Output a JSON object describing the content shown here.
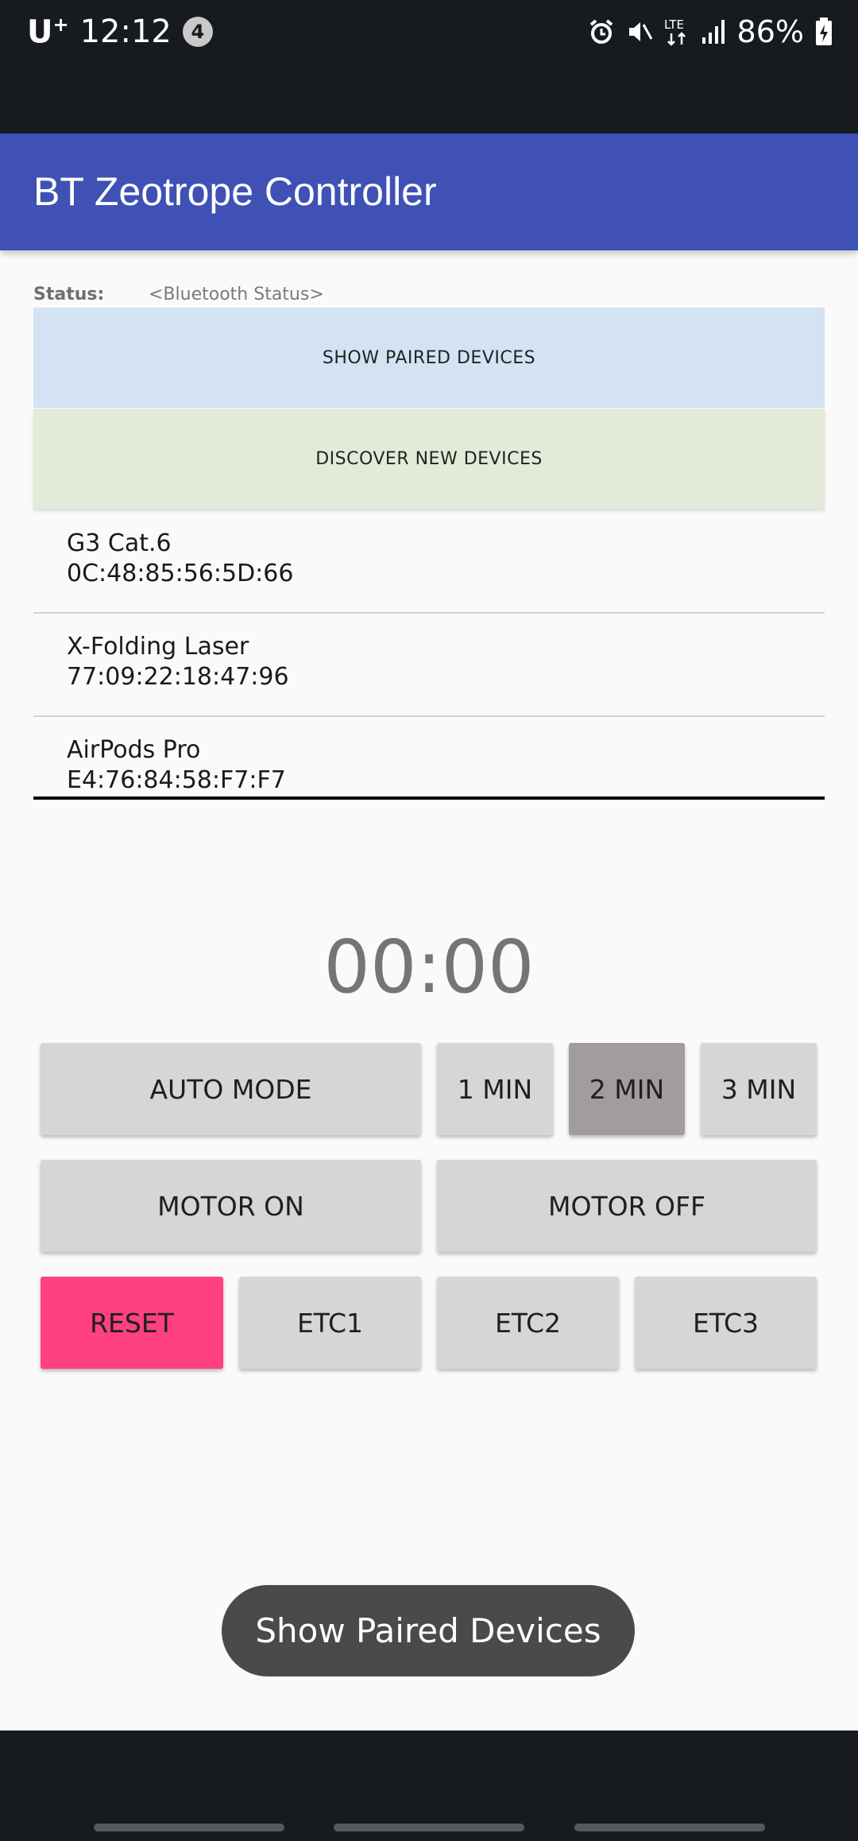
{
  "status_bar": {
    "carrier": "U",
    "carrier_sup": "+",
    "time": "12:12",
    "notification_count": "4",
    "network_label": "LTE",
    "battery": "86%"
  },
  "app_bar": {
    "title": "BT Zeotrope Controller"
  },
  "bt_status": {
    "label": "Status:",
    "value": "<Bluetooth Status>"
  },
  "buttons": {
    "show_paired": "SHOW PAIRED DEVICES",
    "discover": "DISCOVER NEW DEVICES"
  },
  "devices": [
    {
      "name": "G3 Cat.6",
      "address": "0C:48:85:56:5D:66"
    },
    {
      "name": "X-Folding Laser",
      "address": "77:09:22:18:47:96"
    },
    {
      "name": "AirPods Pro",
      "address": "E4:76:84:58:F7:F7"
    }
  ],
  "timer": "00:00",
  "controls": {
    "auto_mode": "AUTO MODE",
    "min1": "1 MIN",
    "min2": "2 MIN",
    "min3": "3 MIN",
    "motor_on": "MOTOR ON",
    "motor_off": "MOTOR OFF",
    "reset": "RESET",
    "etc1": "ETC1",
    "etc2": "ETC2",
    "etc3": "ETC3",
    "selected": "2 MIN"
  },
  "toast": "Show Paired Devices",
  "colors": {
    "app_bar": "#3f51b5",
    "show_paired_bg": "#d3e3f3",
    "discover_bg": "#e3ebd8",
    "reset_bg": "#ff4081",
    "selected_bg": "#a29c9c",
    "button_bg": "#d6d6d6"
  }
}
